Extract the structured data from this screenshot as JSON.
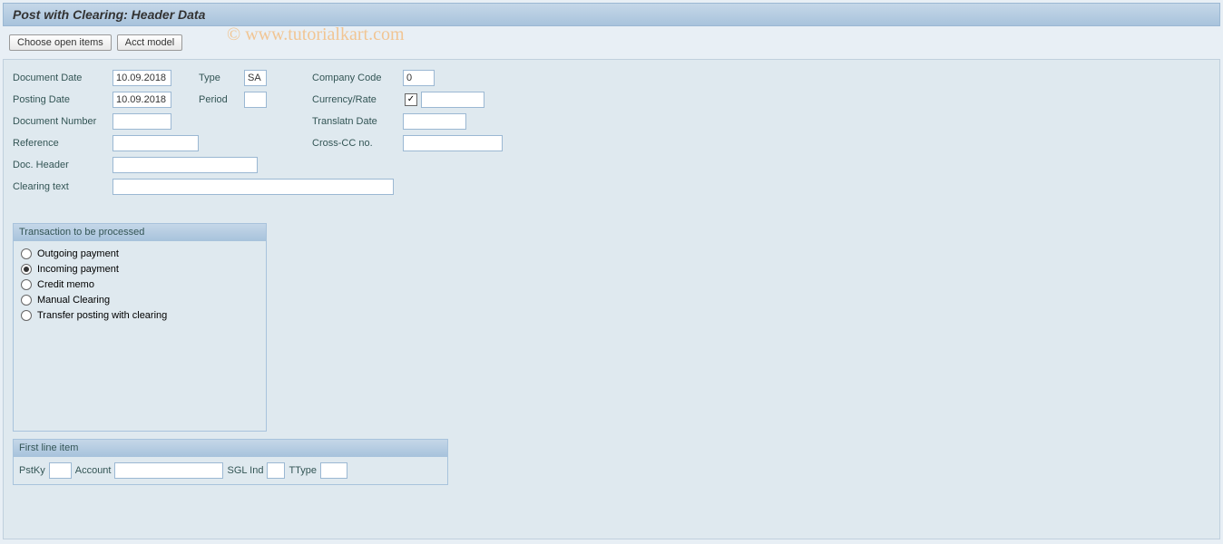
{
  "title": "Post with Clearing: Header Data",
  "watermark": "© www.tutorialkart.com",
  "toolbar": {
    "choose_open_items": "Choose open items",
    "acct_model": "Acct model"
  },
  "header": {
    "document_date_label": "Document Date",
    "document_date": "10.09.2018",
    "type_label": "Type",
    "type": "SA",
    "company_code_label": "Company Code",
    "company_code": "0",
    "posting_date_label": "Posting Date",
    "posting_date": "10.09.2018",
    "period_label": "Period",
    "period": "",
    "currency_rate_label": "Currency/Rate",
    "currency": "",
    "rate": "",
    "document_number_label": "Document Number",
    "document_number": "",
    "translatn_date_label": "Translatn Date",
    "translatn_date": "",
    "reference_label": "Reference",
    "reference": "",
    "cross_cc_no_label": "Cross-CC no.",
    "cross_cc_no": "",
    "doc_header_label": "Doc. Header",
    "doc_header": "",
    "clearing_text_label": "Clearing text",
    "clearing_text": ""
  },
  "transaction": {
    "title": "Transaction to be processed",
    "options": [
      {
        "label": "Outgoing payment",
        "selected": false
      },
      {
        "label": "Incoming payment",
        "selected": true
      },
      {
        "label": "Credit memo",
        "selected": false
      },
      {
        "label": "Manual Clearing",
        "selected": false
      },
      {
        "label": "Transfer posting with clearing",
        "selected": false
      }
    ]
  },
  "first_line_item": {
    "title": "First line item",
    "pstky_label": "PstKy",
    "pstky": "",
    "account_label": "Account",
    "account": "",
    "sgl_ind_label": "SGL Ind",
    "sgl_ind": "",
    "ttype_label": "TType",
    "ttype": ""
  }
}
